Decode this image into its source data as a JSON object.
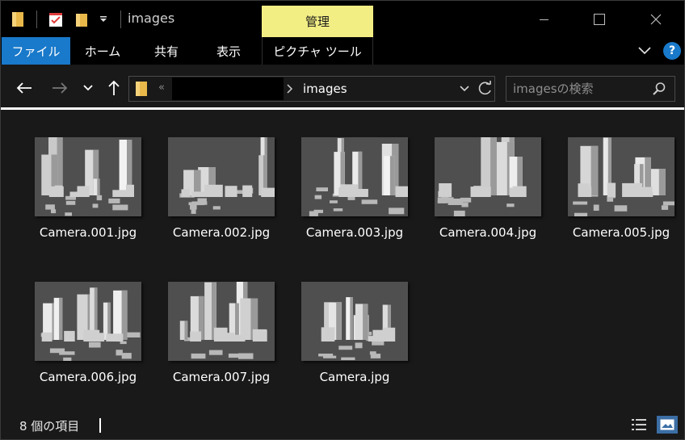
{
  "window": {
    "title": "images",
    "context_tab": "管理",
    "accent": "#1979ca",
    "context_color": "#f3ee84"
  },
  "quick_access": {
    "icons": [
      "folder-icon",
      "properties-icon",
      "new-folder-icon",
      "customize-dropdown-icon"
    ]
  },
  "ribbon": {
    "tabs": [
      {
        "label": "ファイル"
      },
      {
        "label": "ホーム"
      },
      {
        "label": "共有"
      },
      {
        "label": "表示"
      },
      {
        "label": "ピクチャ ツール"
      }
    ]
  },
  "nav": {
    "address": {
      "overflow_marker": "«",
      "crumb": "images"
    },
    "search": {
      "placeholder": "imagesの検索"
    }
  },
  "files": [
    {
      "name": "Camera.001.jpg",
      "variant": 1
    },
    {
      "name": "Camera.002.jpg",
      "variant": 2
    },
    {
      "name": "Camera.003.jpg",
      "variant": 3
    },
    {
      "name": "Camera.004.jpg",
      "variant": 4
    },
    {
      "name": "Camera.005.jpg",
      "variant": 5
    },
    {
      "name": "Camera.006.jpg",
      "variant": 6
    },
    {
      "name": "Camera.007.jpg",
      "variant": 7
    },
    {
      "name": "Camera.jpg",
      "variant": 8
    }
  ],
  "status": {
    "count_text": "8 個の項目"
  }
}
